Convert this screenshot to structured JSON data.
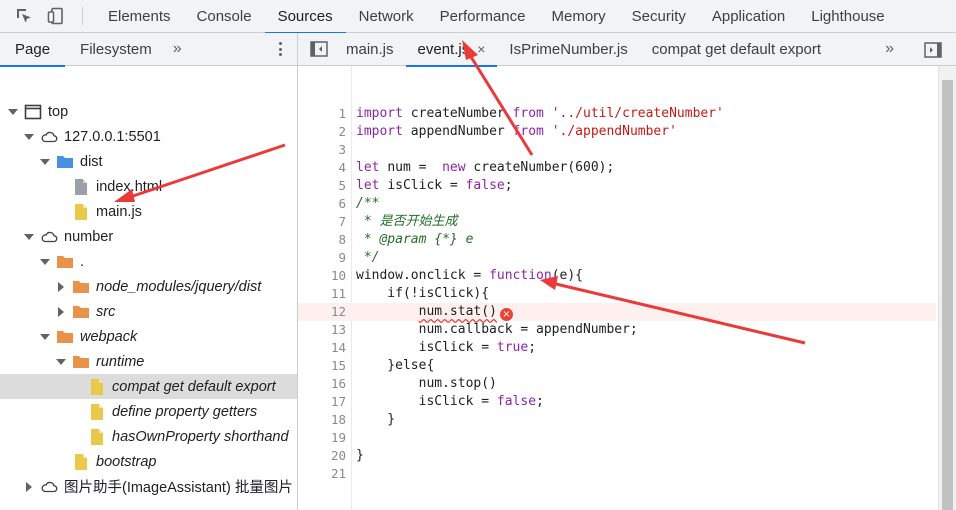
{
  "toolbar": {
    "tabs": [
      "Elements",
      "Console",
      "Sources",
      "Network",
      "Performance",
      "Memory",
      "Security",
      "Application",
      "Lighthouse"
    ],
    "active_tab": "Sources"
  },
  "navigator": {
    "tabs": [
      "Page",
      "Filesystem"
    ],
    "more": "»",
    "tree": [
      {
        "label": "top",
        "icon": "window-icon"
      },
      {
        "label": "127.0.0.1:5501",
        "icon": "cloud-icon"
      },
      {
        "label": "dist",
        "icon": "folder-icon"
      },
      {
        "label": "index.html",
        "icon": "file-icon"
      },
      {
        "label": "main.js",
        "icon": "file-icon"
      },
      {
        "label": "number",
        "icon": "cloud-icon"
      },
      {
        "label": ".",
        "icon": "folder-icon"
      },
      {
        "label": "node_modules/jquery/dist",
        "icon": "folder-icon"
      },
      {
        "label": "src",
        "icon": "folder-icon"
      },
      {
        "label": "webpack",
        "icon": "folder-icon"
      },
      {
        "label": "runtime",
        "icon": "folder-icon"
      },
      {
        "label": "compat get default export",
        "icon": "file-icon"
      },
      {
        "label": "define property getters",
        "icon": "file-icon"
      },
      {
        "label": "hasOwnProperty shorthand",
        "icon": "file-icon"
      },
      {
        "label": "bootstrap",
        "icon": "file-icon"
      },
      {
        "label": "图片助手(ImageAssistant) 批量图片",
        "icon": "cloud-icon"
      }
    ]
  },
  "editor": {
    "tabs": [
      "main.js",
      "event.js",
      "IsPrimeNumber.js",
      "compat get default export"
    ],
    "active_tab": "event.js",
    "close": "×",
    "more": "»",
    "lines": [
      {
        "n": "1",
        "tokens": [
          {
            "t": "import ",
            "c": "kw"
          },
          {
            "t": "createNumber ",
            "c": ""
          },
          {
            "t": "from ",
            "c": "kw"
          },
          {
            "t": "'../util/createNumber'",
            "c": "str"
          }
        ]
      },
      {
        "n": "2",
        "tokens": [
          {
            "t": "import ",
            "c": "kw"
          },
          {
            "t": "appendNumber ",
            "c": ""
          },
          {
            "t": "from ",
            "c": "kw"
          },
          {
            "t": "'./appendNumber'",
            "c": "str"
          }
        ]
      },
      {
        "n": "3",
        "tokens": []
      },
      {
        "n": "4",
        "tokens": [
          {
            "t": "let ",
            "c": "kw"
          },
          {
            "t": "num =  ",
            "c": ""
          },
          {
            "t": "new ",
            "c": "kw"
          },
          {
            "t": "createNumber(600);",
            "c": ""
          }
        ]
      },
      {
        "n": "5",
        "tokens": [
          {
            "t": "let ",
            "c": "kw"
          },
          {
            "t": "isClick = ",
            "c": ""
          },
          {
            "t": "false",
            "c": "kw"
          },
          {
            "t": ";",
            "c": ""
          }
        ]
      },
      {
        "n": "6",
        "tokens": [
          {
            "t": "/**",
            "c": "cmt"
          }
        ]
      },
      {
        "n": "7",
        "tokens": [
          {
            "t": " * 是否开始生成",
            "c": "cmt"
          }
        ]
      },
      {
        "n": "8",
        "tokens": [
          {
            "t": " * @param {*} e",
            "c": "cmt"
          }
        ]
      },
      {
        "n": "9",
        "tokens": [
          {
            "t": " */",
            "c": "cmt"
          }
        ]
      },
      {
        "n": "10",
        "tokens": [
          {
            "t": "window.onclick = ",
            "c": ""
          },
          {
            "t": "function",
            "c": "kw"
          },
          {
            "t": "(e){",
            "c": ""
          }
        ]
      },
      {
        "n": "11",
        "tokens": [
          {
            "t": "    if(!isClick){",
            "c": ""
          }
        ]
      },
      {
        "n": "12",
        "tokens": [
          {
            "t": "        ",
            "c": ""
          },
          {
            "t": "num.stat()",
            "c": "squig"
          }
        ],
        "error": true
      },
      {
        "n": "13",
        "tokens": [
          {
            "t": "        num.callback = appendNumber;",
            "c": ""
          }
        ]
      },
      {
        "n": "14",
        "tokens": [
          {
            "t": "        isClick = ",
            "c": ""
          },
          {
            "t": "true",
            "c": "kw"
          },
          {
            "t": ";",
            "c": ""
          }
        ]
      },
      {
        "n": "15",
        "tokens": [
          {
            "t": "    }else{",
            "c": ""
          }
        ]
      },
      {
        "n": "16",
        "tokens": [
          {
            "t": "        num.stop()",
            "c": ""
          }
        ]
      },
      {
        "n": "17",
        "tokens": [
          {
            "t": "        isClick = ",
            "c": ""
          },
          {
            "t": "false",
            "c": "kw"
          },
          {
            "t": ";",
            "c": ""
          }
        ]
      },
      {
        "n": "18",
        "tokens": [
          {
            "t": "    }",
            "c": ""
          }
        ]
      },
      {
        "n": "19",
        "tokens": []
      },
      {
        "n": "20",
        "tokens": [
          {
            "t": "}",
            "c": ""
          }
        ]
      },
      {
        "n": "21",
        "tokens": []
      }
    ],
    "error_symbol": "×"
  },
  "colors": {
    "accent": "#1a73e8",
    "folder_blue": "#4a90e2",
    "folder_orange": "#e8924a",
    "file_yellow": "#e8c94a",
    "annotation": "#ea3a3a"
  }
}
